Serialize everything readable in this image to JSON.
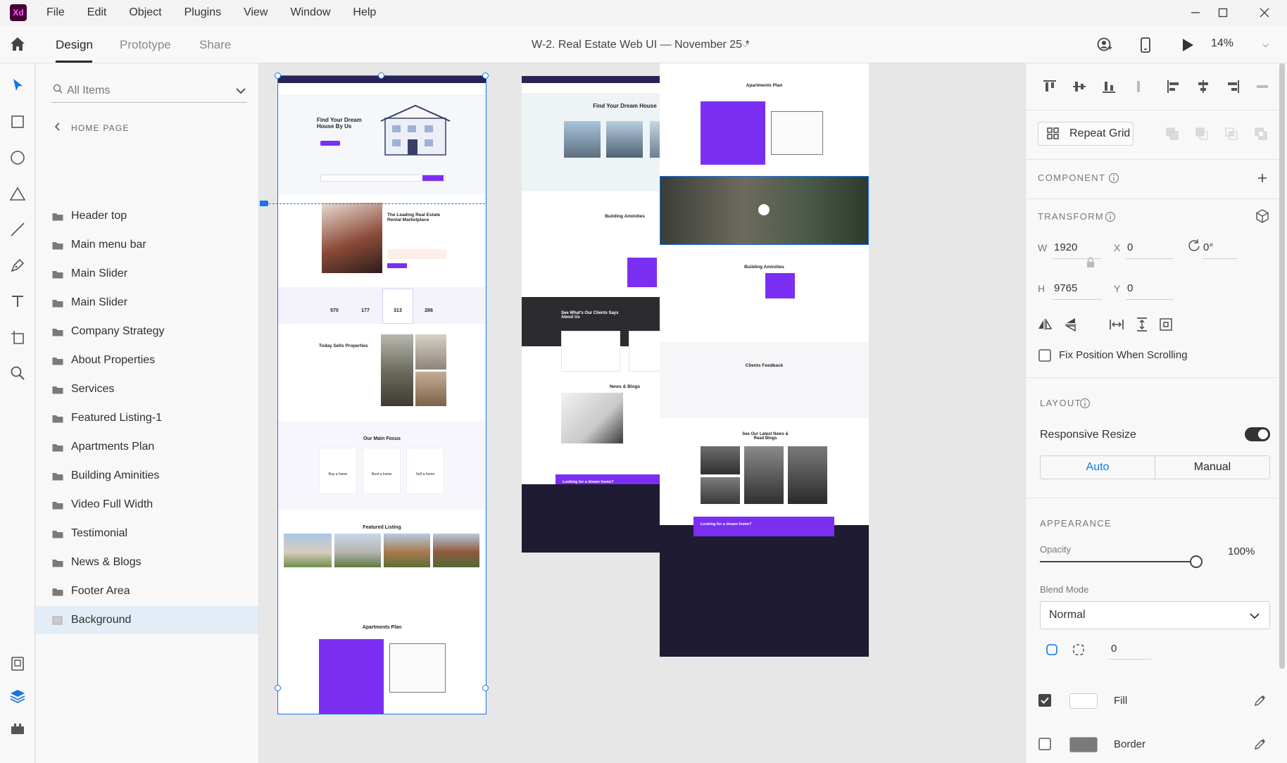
{
  "menu": {
    "app_logo": "Xd",
    "items": [
      "File",
      "Edit",
      "Object",
      "Plugins",
      "View",
      "Window",
      "Help"
    ]
  },
  "toolbar": {
    "tabs": [
      "Design",
      "Prototype",
      "Share"
    ],
    "active_tab": "Design",
    "document_title": "W-2. Real Estate Web UI — November 25 *",
    "zoom": "14%"
  },
  "layers": {
    "search_placeholder": "All Items",
    "breadcrumb": "HOME PAGE",
    "items": [
      "Header top",
      "Main menu bar",
      "Main Slider",
      "Main Slider",
      "Company Strategy",
      "About Properties",
      "Services",
      "Featured Listing-1",
      "Apartments Plan",
      "Building Aminities",
      "Video Full Width",
      "Testimonial",
      "News & Blogs",
      "Footer Area",
      "Background"
    ],
    "selected": "Background"
  },
  "canvas": {
    "artboard1": {
      "hero_title": "Find Your Dream House By Us",
      "about_title": "The Leading Real Estate Rental Marketplace",
      "stats": [
        "570",
        "177",
        "313",
        "286"
      ],
      "today_sells": "Today Sells Properties",
      "main_focus": "Our Main Focus",
      "focus_cards": [
        "Buy a home",
        "Rent a home",
        "Sell a home"
      ],
      "featured": "Featured Listing",
      "apartments": "Apartments Plan"
    },
    "artboard2": {
      "hero_title": "Find Your Dream House",
      "amenities": "Building Aminities",
      "clients": "See What's Our Clients Says About Us",
      "news": "News & Blogs",
      "cta": "Looking for a dream home?"
    },
    "artboard3": {
      "apartments": "Apartments Plan",
      "amenities": "Building Aminities",
      "feedback": "Clients Feedback",
      "news": "See Our Latest News & Read Blogs",
      "cta": "Looking for a dream home?"
    },
    "colors": {
      "accent": "#7b2ff2",
      "footer": "#1e1b33",
      "selection": "#1a73e8"
    }
  },
  "properties": {
    "repeat_grid": "Repeat Grid",
    "component": "COMPONENT",
    "transform": "TRANSFORM",
    "w_label": "W",
    "w_value": "1920",
    "x_label": "X",
    "x_value": "0",
    "rotation": "0°",
    "h_label": "H",
    "h_value": "9765",
    "y_label": "Y",
    "y_value": "0",
    "fix_position": "Fix Position When Scrolling",
    "layout": "LAYOUT",
    "responsive_resize": "Responsive Resize",
    "responsive_on": true,
    "seg_auto": "Auto",
    "seg_manual": "Manual",
    "appearance": "APPEARANCE",
    "opacity_label": "Opacity",
    "opacity_value": "100%",
    "opacity_fraction": 1.0,
    "blend_label": "Blend Mode",
    "blend_value": "Normal",
    "corner_value": "0",
    "fill_label": "Fill",
    "fill_checked": true,
    "fill_color": "#ffffff",
    "border_label": "Border",
    "border_checked": false,
    "border_color": "#7a7a7a"
  }
}
